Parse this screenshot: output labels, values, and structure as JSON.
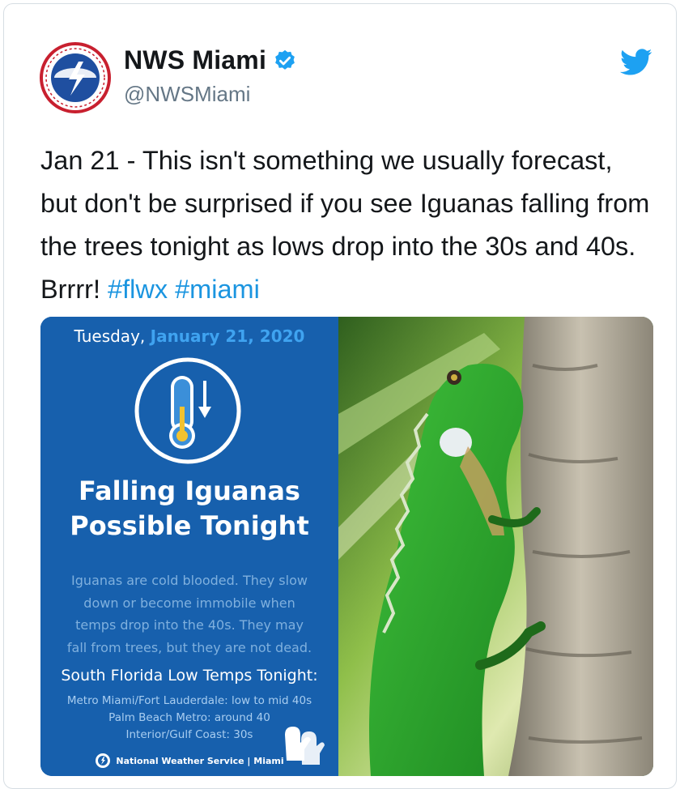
{
  "tweet": {
    "display_name": "NWS Miami",
    "handle": "@NWSMiami",
    "text_main": "Jan 21 - This isn't something we usually forecast, but don't be surprised if you see Iguanas falling from the trees tonight as lows drop into the 30s and 40s. Brrrr! ",
    "hashtags": [
      "#flwx",
      "#miami"
    ],
    "icons": {
      "avatar": "nws-logo-icon",
      "verified": "verified-badge-icon",
      "brand": "twitter-bird-icon"
    },
    "colors": {
      "hashtag": "#1b95e0",
      "verified": "#1da1f2",
      "text": "#14171a",
      "muted": "#657786"
    }
  },
  "media": {
    "date_prefix": "Tuesday, ",
    "date_accent": "January 21, 2020",
    "headline_1": "Falling Iguanas",
    "headline_2": "Possible Tonight",
    "body_lines": [
      "Iguanas are cold blooded. They slow",
      "down or become immobile when",
      "temps drop into the 40s. They may",
      "fall from trees, but they are not dead."
    ],
    "lows_title": "South Florida Low Temps Tonight:",
    "lows": [
      "Metro Miami/Fort Lauderdale: low to mid 40s",
      "Palm Beach Metro: around 40",
      "Interior/Gulf Coast: 30s"
    ],
    "footer": "National Weather Service | Miami",
    "icons": {
      "thermometer": "thermometer-falling-icon",
      "mittens": "mittens-icon",
      "nws": "nws-logo-icon",
      "photo": "iguana-photo"
    },
    "colors": {
      "panel": "#1760ad",
      "accent": "#3fa3f0"
    }
  }
}
